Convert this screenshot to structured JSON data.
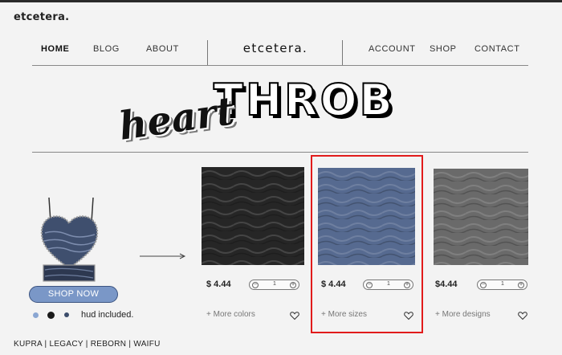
{
  "site": {
    "brand": "etcetera."
  },
  "nav": {
    "left": [
      "HOME",
      "BLOG",
      "ABOUT"
    ],
    "center_logo": "etcetera.",
    "right": [
      "ACCOUNT",
      "SHOP",
      "CONTACT"
    ],
    "active": "HOME"
  },
  "hero": {
    "script_word": "heart",
    "block_word": "THROB"
  },
  "feature": {
    "shop_button": "SHOP NOW",
    "hud_text": "hud included.",
    "color_dots": [
      "#8aa6d2",
      "#1a1a1a",
      "#3c4d6b"
    ]
  },
  "products": [
    {
      "price": "$ 4.44",
      "quantity": "1",
      "more_link": "+ More colors",
      "swatch_color": "#262626"
    },
    {
      "price": "$ 4.44",
      "quantity": "1",
      "more_link": "+ More sizes",
      "swatch_color": "#566a90"
    },
    {
      "price": "$4.44",
      "quantity": "1",
      "more_link": "+ More designs",
      "swatch_color": "#6a6a6a"
    }
  ],
  "footer": {
    "links_text": "KUPRA | LEGACY | REBORN | WAIFU"
  },
  "colors": {
    "accent": "#7a97c7",
    "highlight": "#e11b1b",
    "background": "#f3f3f3"
  }
}
